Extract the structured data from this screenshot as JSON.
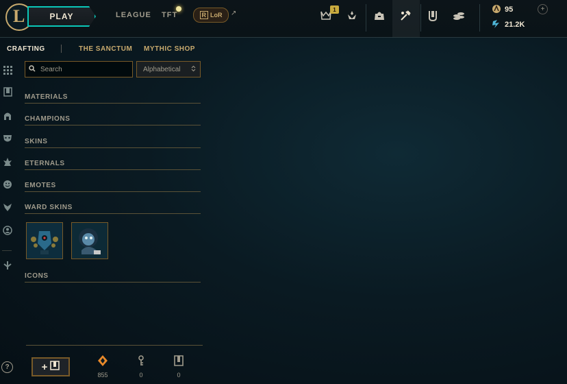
{
  "topbar": {
    "play_label": "PLAY",
    "nav": [
      "LEAGUE",
      "TFT"
    ],
    "lor_label": "LoR",
    "lor_arrow": "↗",
    "notification_count": "1",
    "icons": [
      "challenges-icon",
      "ranked-icon",
      "loot-bag-icon",
      "crafting-icon",
      "collection-icon",
      "store-icon"
    ]
  },
  "currency": {
    "rp": "95",
    "be": "21.2K",
    "plus": "+"
  },
  "subnav": {
    "tabs": [
      "CRAFTING",
      "THE SANCTUM",
      "MYTHIC SHOP"
    ]
  },
  "search": {
    "placeholder": "Search",
    "sort_value": "Alphabetical"
  },
  "categories": [
    "MATERIALS",
    "CHAMPIONS",
    "SKINS",
    "ETERNALS",
    "EMOTES",
    "WARD SKINS",
    "ICONS"
  ],
  "footer": {
    "add_label": "+",
    "orange_essence": "855",
    "keys": "0",
    "chests": "0",
    "help": "?"
  },
  "colors": {
    "gold": "#c8aa6e",
    "teal": "#0ac8b9",
    "background": "#0a1a22"
  }
}
